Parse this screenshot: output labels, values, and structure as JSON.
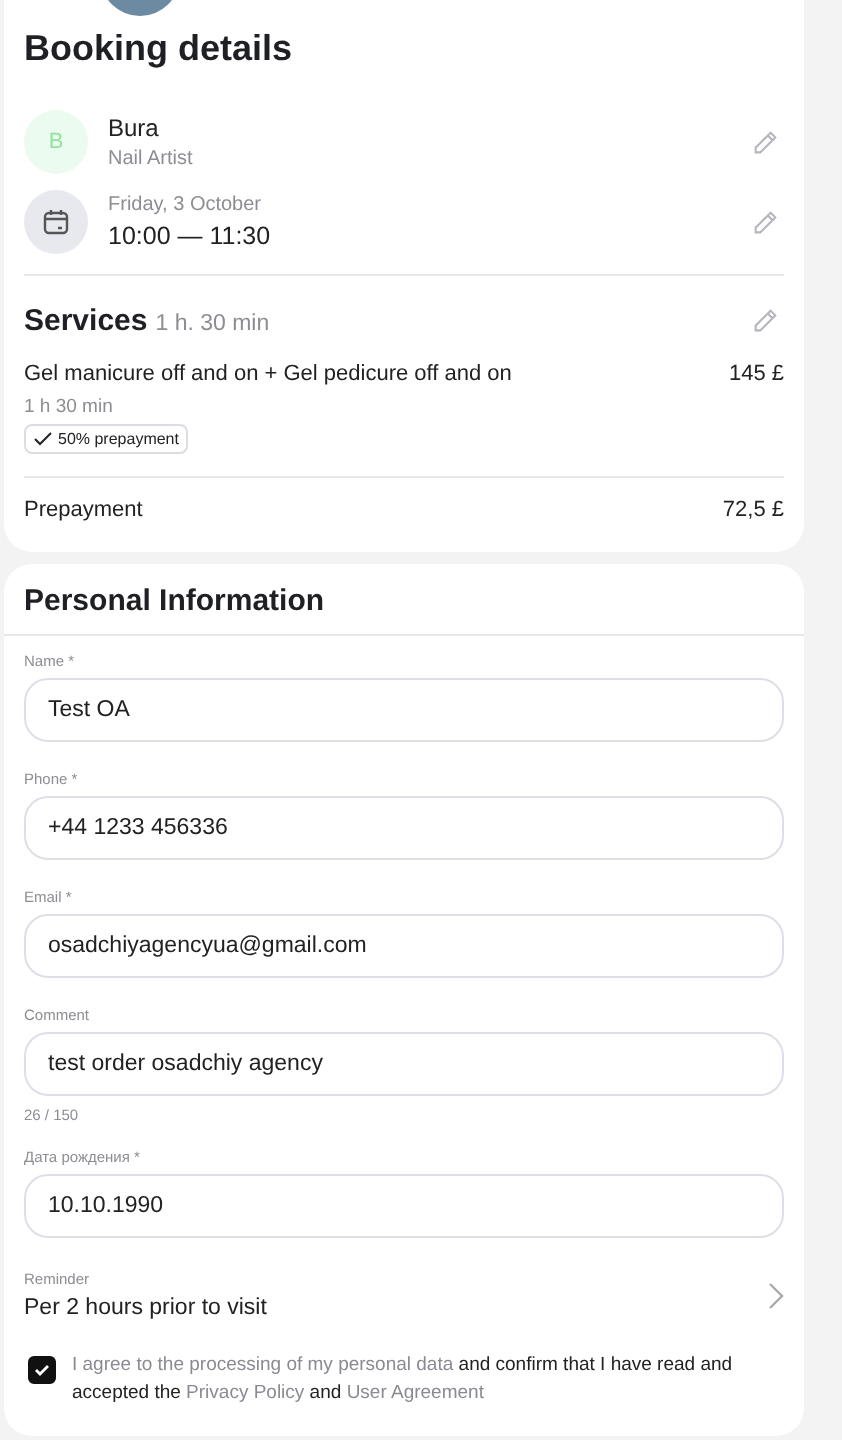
{
  "booking": {
    "title": "Booking details",
    "specialist": {
      "initial": "B",
      "name": "Bura",
      "role": "Nail Artist"
    },
    "datetime": {
      "date": "Friday, 3 October",
      "time": "10:00 — 11:30"
    },
    "services": {
      "title": "Services",
      "duration": "1 h. 30 min",
      "items": [
        {
          "name": "Gel manicure off and on + Gel pedicure off and on",
          "price": "145 £",
          "duration": "1 h 30 min",
          "badge": "50% prepayment"
        }
      ]
    },
    "prepayment": {
      "label": "Prepayment",
      "value": "72,5 £"
    }
  },
  "personal": {
    "title": "Personal Information",
    "fields": [
      {
        "label": "Name *",
        "value": "Test OA"
      },
      {
        "label": "Phone *",
        "value": "+44 1233 456336"
      },
      {
        "label": "Email *",
        "value": "osadchiyagencyua@gmail.com"
      },
      {
        "label": "Comment",
        "value": "test order osadchiy agency",
        "counter": "26 / 150"
      },
      {
        "label": "Дата рождения *",
        "value": "10.10.1990"
      }
    ],
    "reminder": {
      "label": "Reminder",
      "value": "Per 2 hours prior to visit"
    },
    "consent": {
      "checked": true,
      "parts": [
        {
          "kind": "link",
          "text": "I agree to the processing of my personal data"
        },
        {
          "kind": "text",
          "text": " and confirm that I have read and accepted the "
        },
        {
          "kind": "link",
          "text": "Privacy Policy"
        },
        {
          "kind": "text",
          "text": " and "
        },
        {
          "kind": "link",
          "text": "User Agreement"
        }
      ]
    }
  }
}
